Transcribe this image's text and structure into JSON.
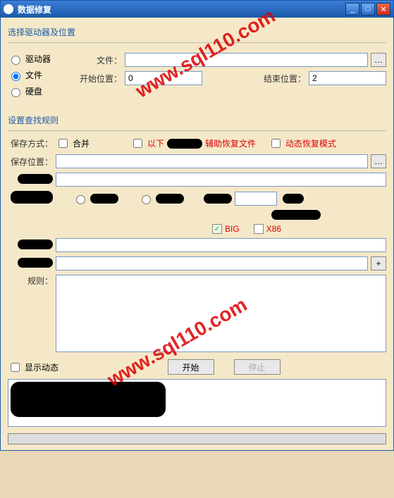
{
  "window": {
    "title": "数据修复"
  },
  "section1": {
    "title": "选择驱动器及位置"
  },
  "radios": {
    "drive": "驱动器",
    "file": "文件",
    "disk": "硬盘"
  },
  "file": {
    "label": "文件：",
    "value": ""
  },
  "startPos": {
    "label": "开始位置：",
    "value": "0"
  },
  "endPos": {
    "label": "结束位置：",
    "value": "2"
  },
  "section2": {
    "title": "设置查找规则"
  },
  "saveMode": {
    "label": "保存方式：",
    "merge": "合并",
    "aux": "辅助恢复文件",
    "auxPrefix": "以下",
    "dynMode": "动态恢复模式"
  },
  "saveLoc": {
    "label": "保存位置：",
    "value": ""
  },
  "arch": {
    "big": "BIG",
    "x86": "X86"
  },
  "rules": {
    "label": "规则：",
    "value": ""
  },
  "showDyn": {
    "label": "显示动态"
  },
  "buttons": {
    "start": "开始",
    "stop": "停止"
  },
  "watermark": "www.sql110.com"
}
